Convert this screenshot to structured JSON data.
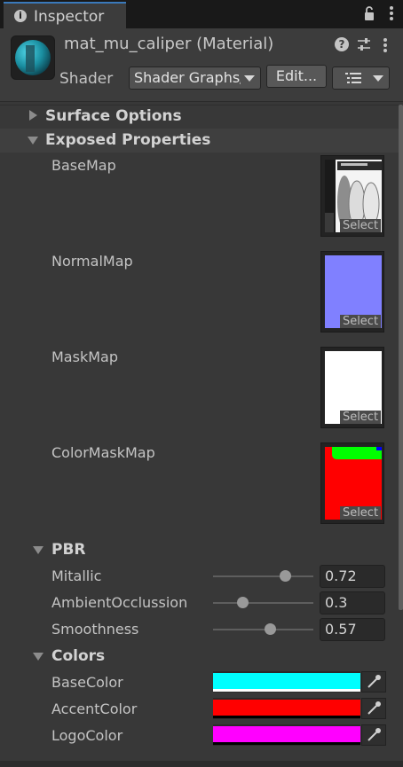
{
  "tab": {
    "title": "Inspector",
    "info_icon": "info-icon",
    "lock_icon": "lock-icon",
    "menu_icon": "kebab-menu-icon"
  },
  "header": {
    "title": "mat_mu_caliper (Material)",
    "shader_label": "Shader",
    "shader_value": "Shader Graphs/",
    "edit_button": "Edit...",
    "help_icon": "?"
  },
  "sections": {
    "surface_options": "Surface Options",
    "exposed_properties": "Exposed Properties",
    "pbr": "PBR",
    "colors": "Colors"
  },
  "textures": [
    {
      "label": "BaseMap",
      "select": "Select"
    },
    {
      "label": "NormalMap",
      "select": "Select"
    },
    {
      "label": "MaskMap",
      "select": "Select"
    },
    {
      "label": "ColorMaskMap",
      "select": "Select"
    }
  ],
  "pbr": [
    {
      "label": "Mitallic",
      "value": "0.72",
      "fraction": 0.72
    },
    {
      "label": "AmbientOcclussion",
      "value": "0.3",
      "fraction": 0.3
    },
    {
      "label": "Smoothness",
      "value": "0.57",
      "fraction": 0.57
    }
  ],
  "colors": [
    {
      "label": "BaseColor",
      "hex": "#00FFFF"
    },
    {
      "label": "AccentColor",
      "hex": "#FF0000"
    },
    {
      "label": "LogoColor",
      "hex": "#FF00FF"
    }
  ],
  "theme": {
    "accent": "#3A79BB",
    "background": "#383838"
  }
}
